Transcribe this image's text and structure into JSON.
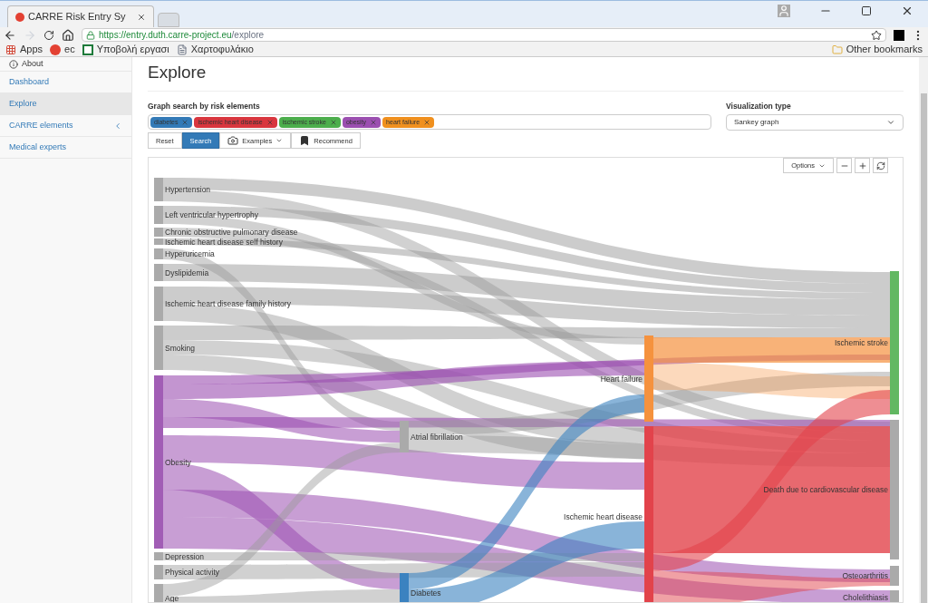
{
  "browser": {
    "tab_title": "CARRE Risk Entry Sy",
    "url_host": "https://entry.duth.carre-project.eu",
    "url_path": "/explore",
    "bookmarks": [
      {
        "label": "Apps",
        "kind": "apps"
      },
      {
        "label": "ec",
        "kind": "logo"
      },
      {
        "label": "Υποβολή εργασι",
        "kind": "sheet"
      },
      {
        "label": "Χαρτοφυλάκιο",
        "kind": "page"
      }
    ],
    "other_bookmarks": "Other bookmarks"
  },
  "sidebar": {
    "items": [
      {
        "label": "About",
        "selected": false,
        "kind": "info"
      },
      {
        "label": "Dashboard",
        "selected": false,
        "kind": "link"
      },
      {
        "label": "Explore",
        "selected": true,
        "kind": "link"
      },
      {
        "label": "CARRE elements",
        "selected": false,
        "kind": "expand"
      },
      {
        "label": "Medical experts",
        "selected": false,
        "kind": "link"
      }
    ]
  },
  "page_title": "Explore",
  "search": {
    "label": "Graph search by risk elements",
    "tags": [
      {
        "label": "diabetes",
        "color": "#337ab7"
      },
      {
        "label": "ischemic heart disease",
        "color": "#d9363e"
      },
      {
        "label": "ischemic stroke",
        "color": "#4cae4c"
      },
      {
        "label": "obesity",
        "color": "#9b4fb0"
      },
      {
        "label": "heart failure",
        "color": "#f0901e"
      }
    ],
    "buttons": [
      {
        "label": "Reset",
        "kind": "plain",
        "selected": false
      },
      {
        "label": "Search",
        "kind": "plain",
        "selected": true
      },
      {
        "label": "Examples",
        "kind": "camera",
        "selected": false
      },
      {
        "label": "Recommend",
        "kind": "bookmark",
        "selected": false
      }
    ]
  },
  "visualization": {
    "label": "Visualization type",
    "value": "Sankey graph"
  },
  "graph": {
    "options": "Options",
    "nodes": [
      {
        "label": "Hypertension",
        "color": "#aaaaaa"
      },
      {
        "label": "Left ventricular hypertrophy",
        "color": "#aaaaaa"
      },
      {
        "label": "Chronic obstructive pulmonary disease",
        "color": "#aaaaaa"
      },
      {
        "label": "Ischemic heart disease self history",
        "color": "#aaaaaa"
      },
      {
        "label": "Hyperuricemia",
        "color": "#aaaaaa"
      },
      {
        "label": "Dyslipidemia",
        "color": "#aaaaaa"
      },
      {
        "label": "Ischemic heart disease family history",
        "color": "#aaaaaa"
      },
      {
        "label": "Smoking",
        "color": "#aaaaaa"
      },
      {
        "label": "Obesity",
        "color": "#a15db5"
      },
      {
        "label": "Depression",
        "color": "#aaaaaa"
      },
      {
        "label": "Physical activity",
        "color": "#aaaaaa"
      },
      {
        "label": "Age",
        "color": "#aaaaaa"
      },
      {
        "label": "Atrial fibrillation",
        "color": "#aaaaaa"
      },
      {
        "label": "Diabetes",
        "color": "#3b82c0"
      },
      {
        "label": "Heart failure",
        "color": "#f5923e"
      },
      {
        "label": "Ischemic heart disease",
        "color": "#e2434b"
      },
      {
        "label": "Ischemic stroke",
        "color": "#62b862"
      },
      {
        "label": "Death due to cardiovascular disease",
        "color": "#aaaaaa"
      },
      {
        "label": "Osteoarthritis",
        "color": "#aaaaaa"
      },
      {
        "label": "Cholelithiasis",
        "color": "#aaaaaa"
      }
    ]
  }
}
